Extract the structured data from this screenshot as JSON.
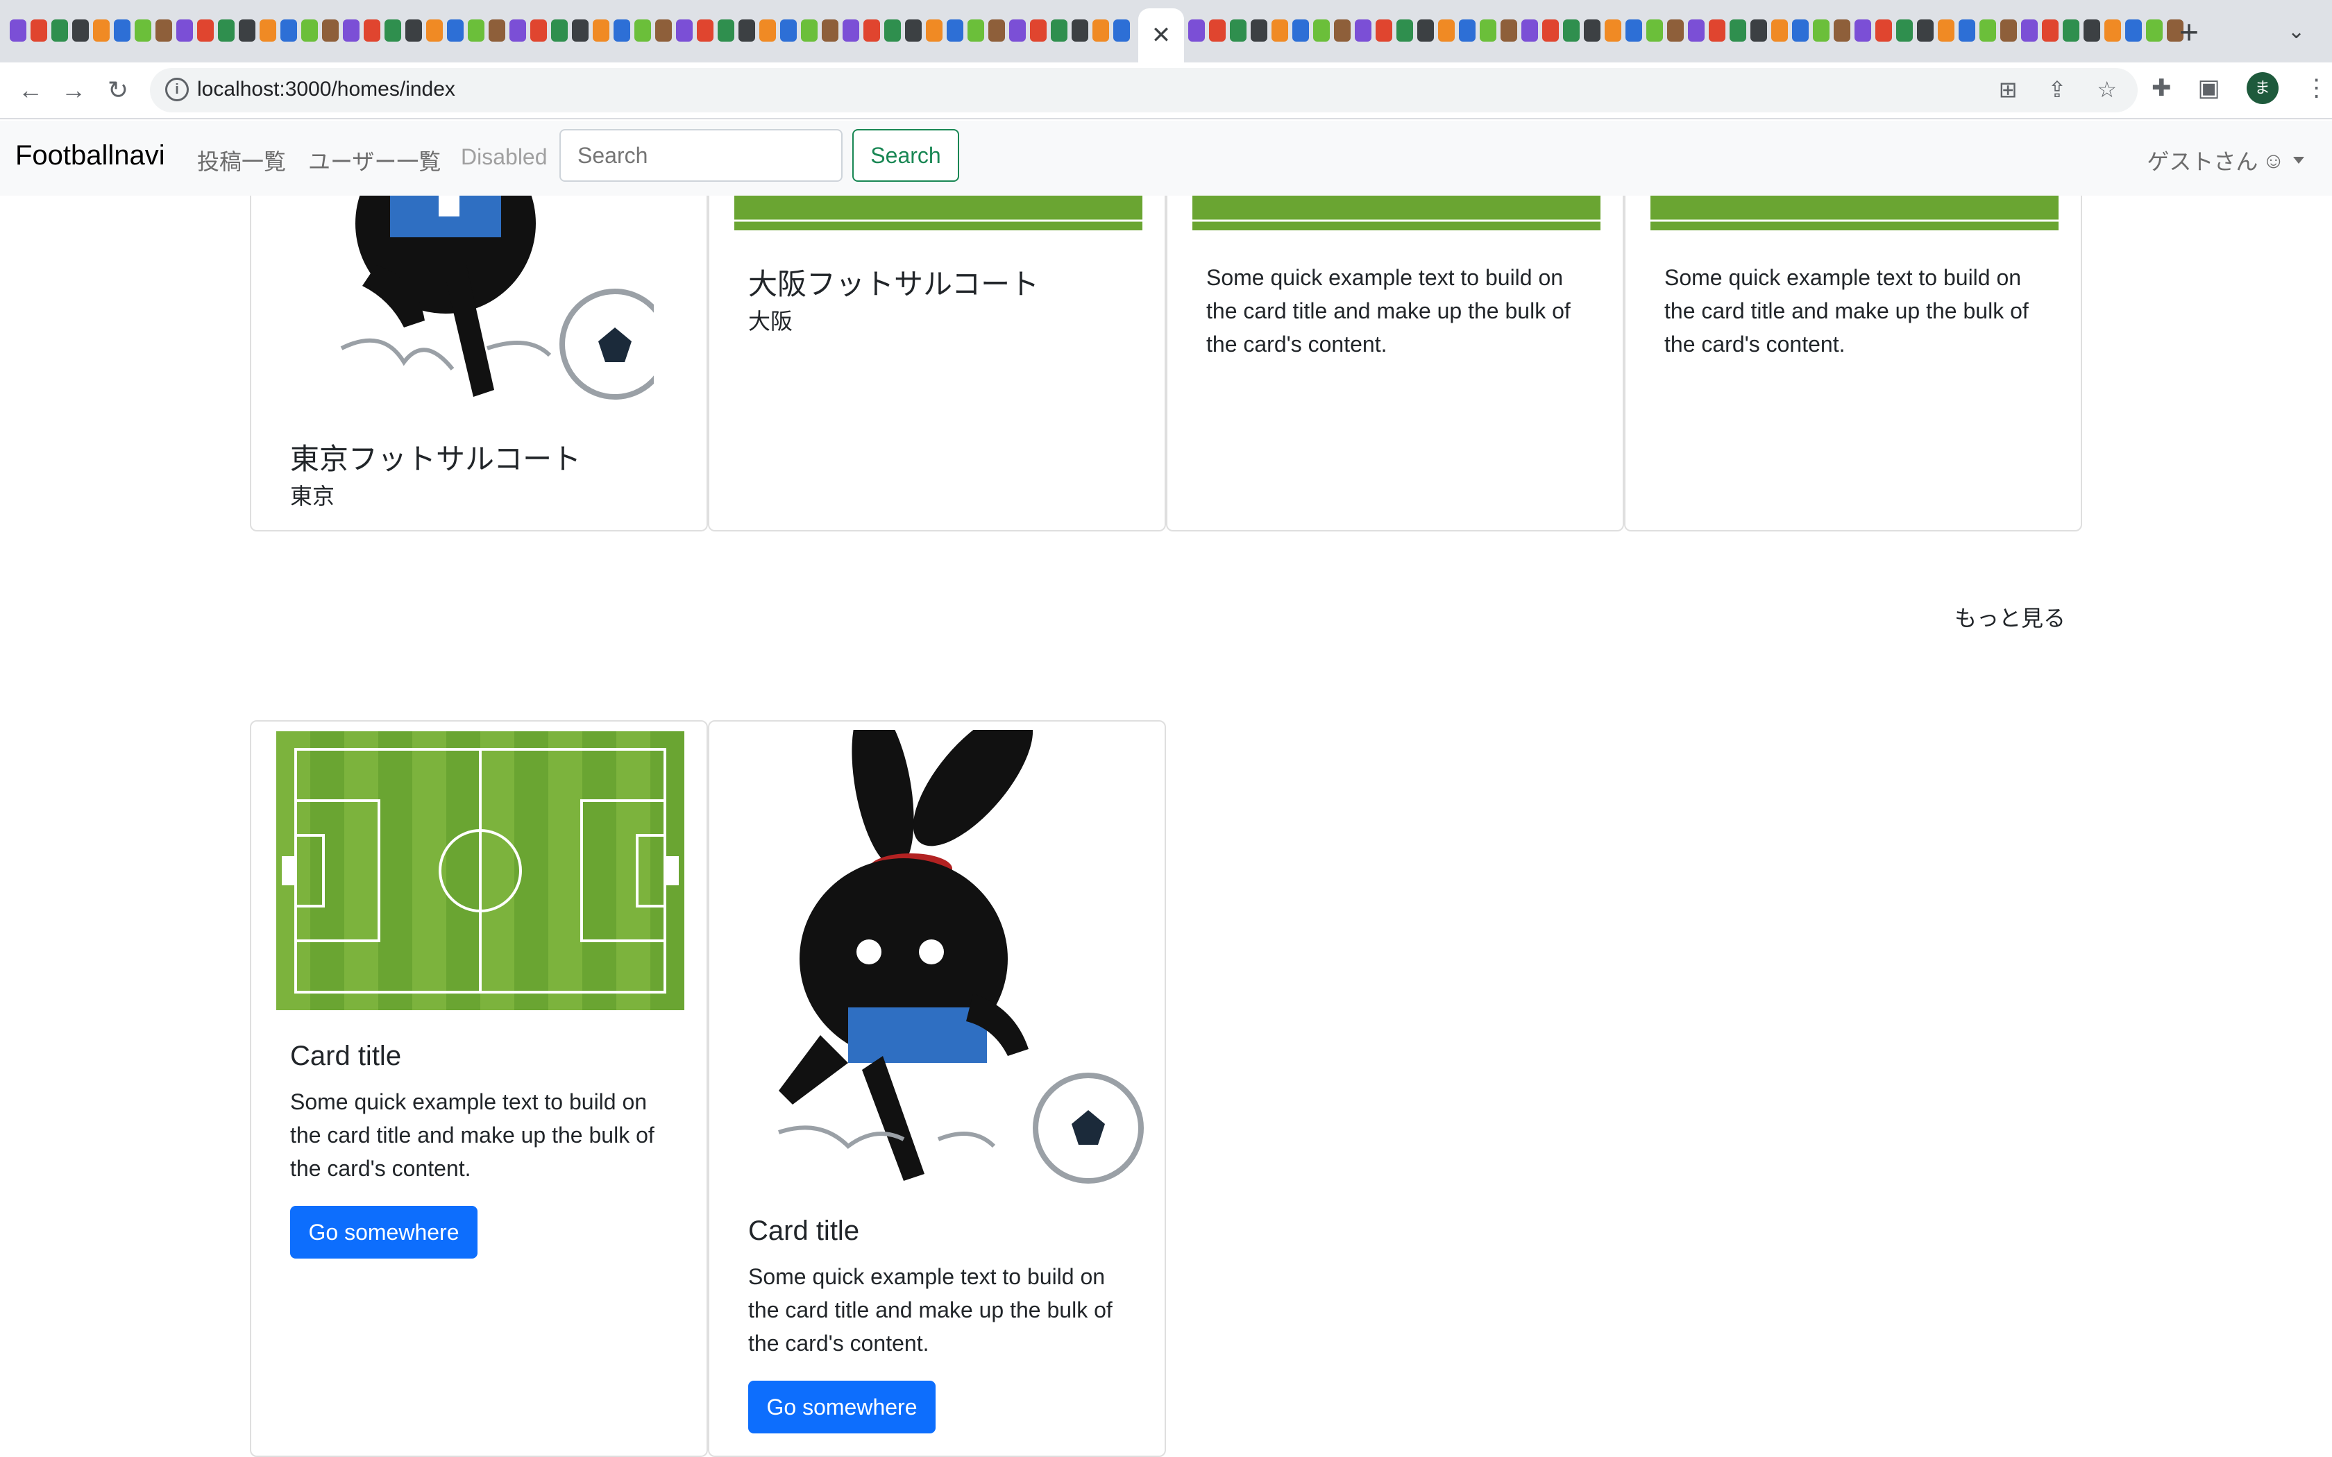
{
  "browser": {
    "url": "localhost:3000/homes/index",
    "active_tab_close": "✕",
    "new_tab": "+",
    "profile_initial": "ま"
  },
  "navbar": {
    "brand": "Footballnavi",
    "links": [
      "投稿一覧",
      "ユーザー一覧",
      "Disabled"
    ],
    "search_placeholder": "Search",
    "search_button": "Search",
    "guest": "ゲストさん"
  },
  "top_cards": [
    {
      "title": "東京フットサルコート",
      "subtitle": "東京"
    },
    {
      "title": "大阪フットサルコート",
      "subtitle": "大阪"
    },
    {
      "text": "Some quick example text to build on the card title and make up the bulk of the card's content."
    },
    {
      "text": "Some quick example text to build on the card title and make up the bulk of the card's content."
    }
  ],
  "more_link": "もっと見る",
  "bottom_cards": [
    {
      "title": "Card title",
      "text": "Some quick example text to build on the card title and make up the bulk of the card's content.",
      "button": "Go somewhere"
    },
    {
      "title": "Card title",
      "text": "Some quick example text to build on the card title and make up the bulk of the card's content.",
      "button": "Go somewhere"
    }
  ],
  "colors": {
    "primary": "#0d6efd",
    "success": "#198754",
    "pitch": "#6aa532"
  }
}
